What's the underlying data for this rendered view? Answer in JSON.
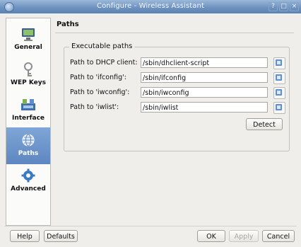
{
  "window": {
    "title": "Configure - Wireless Assistant",
    "controls": [
      "?",
      "□",
      "×"
    ]
  },
  "sidebar": {
    "items": [
      {
        "label": "General",
        "icon": "monitor-icon",
        "active": false
      },
      {
        "label": "WEP Keys",
        "icon": "key-icon",
        "active": false
      },
      {
        "label": "Interface",
        "icon": "network-interface-icon",
        "active": false
      },
      {
        "label": "Paths",
        "icon": "paths-globe-icon",
        "active": true
      },
      {
        "label": "Advanced",
        "icon": "gear-icon",
        "active": false
      }
    ]
  },
  "main": {
    "heading": "Paths",
    "group_title": "Executable paths",
    "rows": [
      {
        "label": "Path to DHCP client:",
        "value": "/sbin/dhclient-script"
      },
      {
        "label": "Path to 'ifconfig':",
        "value": "/sbin/ifconfig"
      },
      {
        "label": "Path to 'iwconfig':",
        "value": "/sbin/iwconfig"
      },
      {
        "label": "Path to 'iwlist':",
        "value": "/sbin/iwlist"
      }
    ],
    "detect_label": "Detect"
  },
  "footer": {
    "help_label": "Help",
    "defaults_label": "Defaults",
    "ok_label": "OK",
    "apply_label": "Apply",
    "cancel_label": "Cancel"
  },
  "colors": {
    "titlebar": "#6f93c0",
    "selection": "#5e86c0"
  }
}
